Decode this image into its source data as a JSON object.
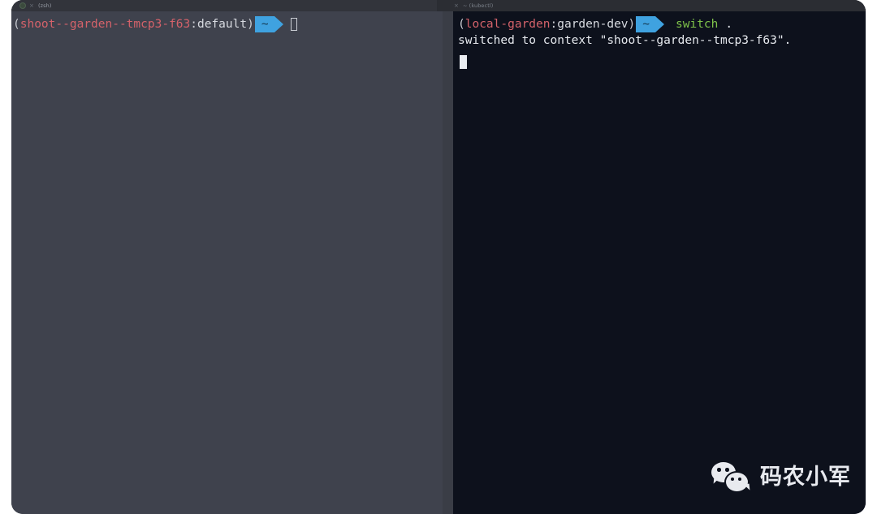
{
  "window": {
    "app": "terminal",
    "background_color": "#2b2d33"
  },
  "tabbar": {
    "left_tab": {
      "label": "(zsh)",
      "dot_icon": "session-indicator-icon",
      "close_icon": "×"
    },
    "right_tab": {
      "label": "~ (kubectl)",
      "close_icon": "×"
    }
  },
  "panes": {
    "left": {
      "background_color": "#3f424d",
      "prompt": {
        "open_paren": "(",
        "context": "shoot--garden--tmcp3-f63",
        "colon": ":",
        "namespace": "default",
        "close_paren": ")",
        "powerline_segment": "~",
        "powerline_color": "#3fa2e0",
        "command": "",
        "cursor": "hollow-box-cursor"
      }
    },
    "right": {
      "background_color": "#0d111c",
      "prompt": {
        "open_paren": "(",
        "context": "local-garden",
        "colon": ":",
        "namespace": "garden-dev",
        "close_paren": ")",
        "powerline_segment": "~",
        "powerline_color": "#3fa2e0",
        "command": "switch",
        "argument": ".",
        "command_color": "#7fc24a"
      },
      "output_lines": [
        "switched to context \"shoot--garden--tmcp3-f63\"."
      ],
      "cursor": "filled-block-cursor"
    }
  },
  "watermark": {
    "icon": "wechat-icon",
    "text": "码农小军"
  }
}
